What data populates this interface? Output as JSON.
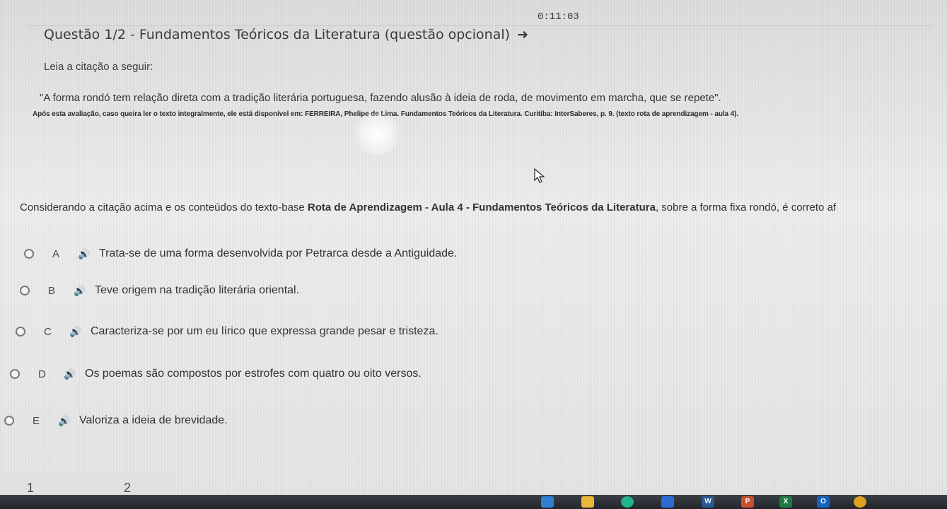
{
  "timer": "0:11:03",
  "question": {
    "title": "Questão 1/2 - Fundamentos Teóricos da Literatura (questão opcional)",
    "arrow_icon": "arrow-right-icon",
    "lead": "Leia a citação a seguir:",
    "quote": "\"A forma rondó tem relação direta com a tradição literária portuguesa, fazendo alusão à ideia de roda, de movimento em marcha, que se repete\".",
    "source": "Após esta avaliação, caso queira ler o texto integralmente, ele está disponível em: FERREIRA, Phelipe de Lima. Fundamentos Teóricos da Literatura. Curitiba: InterSaberes, p. 9. (texto rota de aprendizagem - aula 4).",
    "prompt_start": "Considerando a citação acima e os conteúdos do texto-base ",
    "prompt_bold": "Rota de Aprendizagem - Aula 4 - Fundamentos Teóricos da Literatura",
    "prompt_end": ", sobre a forma fixa rondó, é correto af"
  },
  "options": [
    {
      "letter": "A",
      "text": "Trata-se de uma forma desenvolvida por Petrarca desde a Antiguidade."
    },
    {
      "letter": "B",
      "text": "Teve origem na tradição literária oriental."
    },
    {
      "letter": "C",
      "text": "Caracteriza-se por um eu lírico que expressa grande pesar e tristeza."
    },
    {
      "letter": "D",
      "text": "Os poemas são compostos por estrofes com quatro ou oito versos."
    },
    {
      "letter": "E",
      "text": "Valoriza a ideia de brevidade."
    }
  ],
  "speaker_icon": "🔊",
  "pagination": [
    "1",
    "2"
  ],
  "taskbar": {
    "icons": [
      "file-explorer-icon",
      "folder-icon",
      "edge-icon",
      "store-icon",
      "word-icon",
      "powerpoint-icon",
      "excel-icon",
      "outlook-icon",
      "chrome-icon"
    ],
    "colors": [
      "#2f7fd6",
      "#e8b83b",
      "#1fb48a",
      "#2b6cd4",
      "#2b5797",
      "#c94f2e",
      "#1f7a3f",
      "#1565c0",
      "#e0a31f"
    ]
  }
}
